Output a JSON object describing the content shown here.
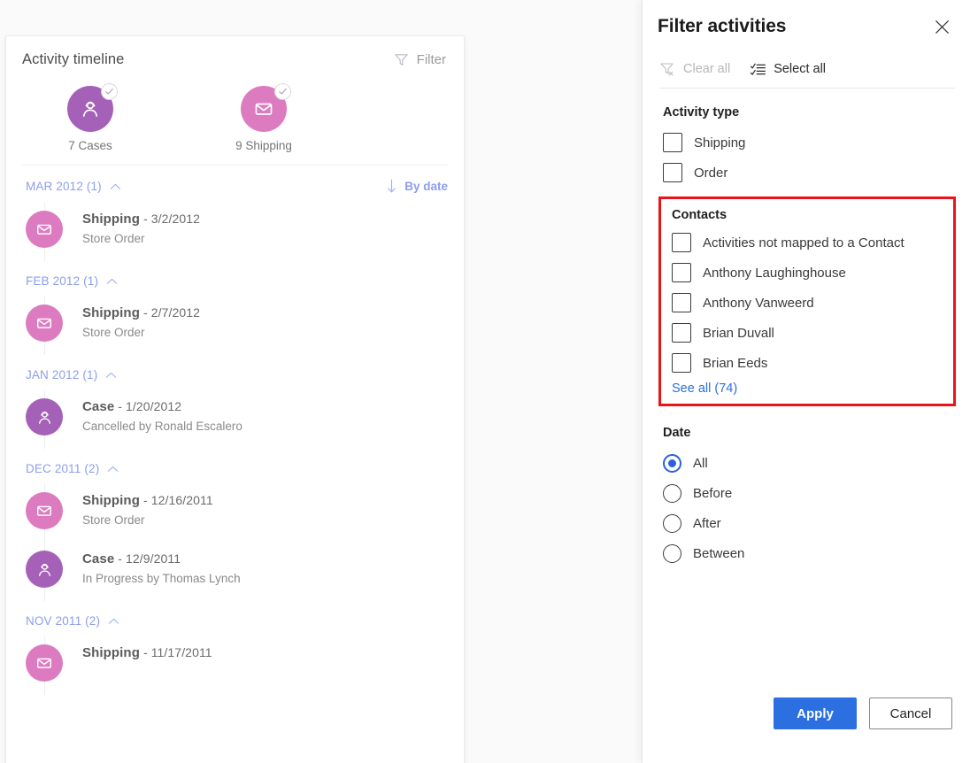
{
  "timeline": {
    "title": "Activity timeline",
    "filter_label": "Filter",
    "filter_icon": "funnel-icon",
    "sort_label": "By date",
    "sort_icon": "arrow-down-icon",
    "summary": [
      {
        "count_label": "7 Cases",
        "icon": "case-agent-icon",
        "color": "#a560b8",
        "badge_icon": "check-circle-icon"
      },
      {
        "count_label": "9 Shipping",
        "icon": "envelope-icon",
        "color": "#dd7bc0",
        "badge_icon": "check-circle-icon"
      }
    ],
    "groups": [
      {
        "header": "MAR 2012 (1)",
        "entries": [
          {
            "type": "Shipping",
            "separator": " - ",
            "date": "3/2/2012",
            "subtitle": "Store Order",
            "icon": "envelope-icon",
            "color": "#dd7bc0"
          }
        ]
      },
      {
        "header": "FEB 2012 (1)",
        "entries": [
          {
            "type": "Shipping",
            "separator": " - ",
            "date": "2/7/2012",
            "subtitle": "Store Order",
            "icon": "envelope-icon",
            "color": "#dd7bc0"
          }
        ]
      },
      {
        "header": "JAN 2012 (1)",
        "entries": [
          {
            "type": "Case",
            "separator": " - ",
            "date": "1/20/2012",
            "subtitle": "Cancelled by Ronald Escalero",
            "icon": "case-agent-icon",
            "color": "#a560b8"
          }
        ]
      },
      {
        "header": "DEC 2011 (2)",
        "entries": [
          {
            "type": "Shipping",
            "separator": " - ",
            "date": "12/16/2011",
            "subtitle": "Store Order",
            "icon": "envelope-icon",
            "color": "#dd7bc0"
          },
          {
            "type": "Case",
            "separator": " - ",
            "date": "12/9/2011",
            "subtitle": "In Progress by Thomas Lynch",
            "icon": "case-agent-icon",
            "color": "#a560b8"
          }
        ]
      },
      {
        "header": "NOV 2011 (2)",
        "entries": [
          {
            "type": "Shipping",
            "separator": " - ",
            "date": "11/17/2011",
            "subtitle": "",
            "icon": "envelope-icon",
            "color": "#dd7bc0"
          }
        ]
      }
    ]
  },
  "flyout": {
    "title": "Filter activities",
    "close_icon": "close-icon",
    "clear_all": {
      "label": "Clear all",
      "icon": "funnel-clear-icon",
      "enabled": false
    },
    "select_all": {
      "label": "Select all",
      "icon": "select-all-icon",
      "enabled": true
    },
    "activity_type": {
      "title": "Activity type",
      "options": [
        {
          "label": "Shipping",
          "checked": false
        },
        {
          "label": "Order",
          "checked": false
        }
      ]
    },
    "contacts": {
      "title": "Contacts",
      "highlight_color": "#e8141a",
      "options": [
        {
          "label": "Activities not mapped to a Contact",
          "checked": false
        },
        {
          "label": "Anthony Laughinghouse",
          "checked": false
        },
        {
          "label": "Anthony Vanweerd",
          "checked": false
        },
        {
          "label": "Brian Duvall",
          "checked": false
        },
        {
          "label": "Brian Eeds",
          "checked": false
        }
      ],
      "see_all": "See all (74)"
    },
    "date": {
      "title": "Date",
      "options": [
        {
          "label": "All",
          "selected": true
        },
        {
          "label": "Before",
          "selected": false
        },
        {
          "label": "After",
          "selected": false
        },
        {
          "label": "Between",
          "selected": false
        }
      ]
    },
    "apply_label": "Apply",
    "cancel_label": "Cancel",
    "accent_color": "#2b6fe0"
  }
}
